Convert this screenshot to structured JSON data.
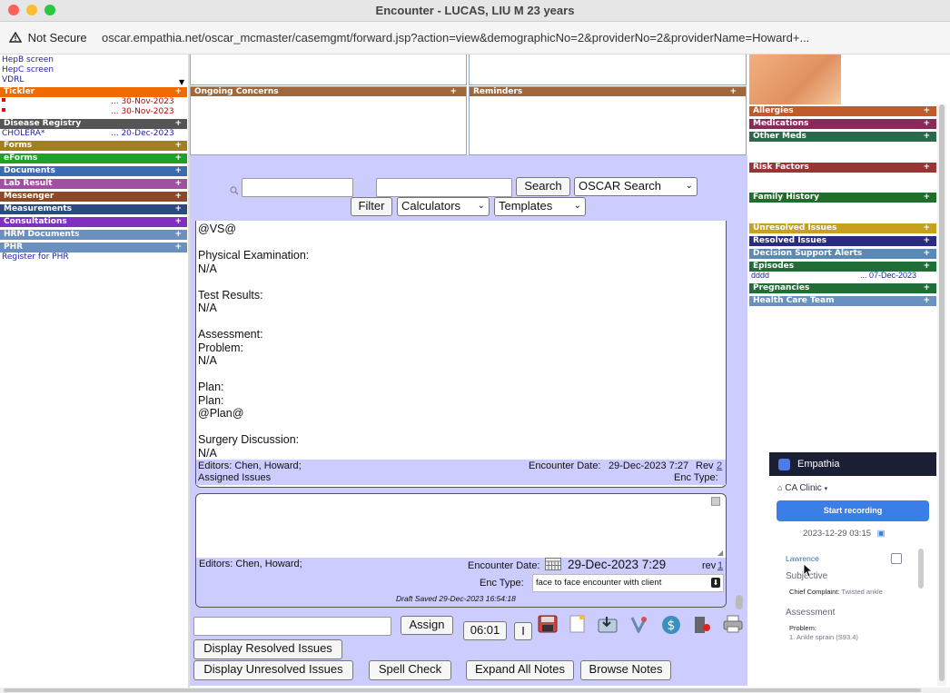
{
  "window": {
    "title": "Encounter - LUCAS, LIU M 23 years"
  },
  "address": {
    "security": "Not Secure",
    "url": "oscar.empathia.net/oscar_mcmaster/casemgmt/forward.jsp?action=view&demographicNo=2&providerNo=2&providerName=Howard+..."
  },
  "left": {
    "links": [
      "HepB screen",
      "HepC screen",
      "VDRL"
    ],
    "tickler": {
      "label": "Tickler",
      "rows": [
        "... 30-Nov-2023",
        "... 30-Nov-2023"
      ]
    },
    "disease_registry": {
      "label": "Disease Registry",
      "row_name": "CHOLERA*",
      "row_date": "... 20-Dec-2023"
    },
    "sections": [
      "Forms",
      "eForms",
      "Documents",
      "Lab Result",
      "Messenger",
      "Measurements",
      "Consultations",
      "HRM Documents",
      "PHR"
    ],
    "phr_link": "Register for PHR",
    "plus": "+"
  },
  "panels": {
    "ongoing": "Ongoing Concerns",
    "reminders": "Reminders"
  },
  "search": {
    "search_button": "Search",
    "oscar_search": "OSCAR Search",
    "filter_button": "Filter",
    "calculators": "Calculators",
    "templates": "Templates"
  },
  "note": {
    "lines": [
      "@VS@",
      "",
      "Physical Examination:",
      "N/A",
      "",
      "Test Results:",
      "N/A",
      "",
      "Assessment:",
      "Problem:",
      "N/A",
      "",
      "Plan:",
      "Plan:",
      "@Plan@",
      "",
      "Surgery Discussion:",
      "N/A"
    ],
    "editors": "Editors: Chen, Howard;",
    "encounter_date_label": "Encounter Date:",
    "encounter_date": "29-Dec-2023 7:27",
    "rev_label": "Rev",
    "rev": "2",
    "assigned_issues": "Assigned Issues",
    "enc_type_label": "Enc Type:"
  },
  "new_note": {
    "editors": "Editors: Chen, Howard;",
    "encounter_date_label": "Encounter Date:",
    "encounter_date": "29-Dec-2023 7:29",
    "rev_label": "rev",
    "rev": "1",
    "enc_type_label": "Enc Type:",
    "enc_type": "face to face encounter with client",
    "draft_saved": "Draft Saved 29-Dec-2023 16:54:18"
  },
  "bottom": {
    "assign": "Assign",
    "timer": "06:01",
    "pause": "I",
    "display_resolved": "Display Resolved Issues",
    "display_unresolved": "Display Unresolved Issues",
    "spell_check": "Spell Check",
    "expand_all": "Expand All Notes",
    "browse": "Browse Notes"
  },
  "right": {
    "sections": [
      {
        "label": "Allergies",
        "color": "#c05a2a"
      },
      {
        "label": "Medications",
        "color": "#8a2a5a"
      },
      {
        "label": "Other Meds",
        "color": "#2a6a4a"
      },
      {
        "label": "Risk Factors",
        "color": "#9a3535"
      },
      {
        "label": "Family History",
        "color": "#1f6e2a"
      },
      {
        "label": "Unresolved Issues",
        "color": "#c8a020"
      },
      {
        "label": "Resolved Issues",
        "color": "#2a2a80"
      },
      {
        "label": "Decision Support Alerts",
        "color": "#5a88b8"
      },
      {
        "label": "Episodes",
        "color": "#1f6e3a"
      },
      {
        "label": "Pregnancies",
        "color": "#1f6e3a"
      },
      {
        "label": "Health Care Team",
        "color": "#6a90c0"
      }
    ],
    "episode_name": "dddd",
    "episode_date": "... 07-Dec-2023"
  },
  "empathia": {
    "title": "Empathia",
    "clinic": "CA Clinic",
    "start": "Start recording",
    "datetime": "2023-12-29 03:15",
    "provider": "Lawrence",
    "subjective": "Subjective",
    "chief_label": "Chief Complaint:",
    "chief_value": "Twisted ankle",
    "assessment": "Assessment",
    "problem_label": "Problem:",
    "problem_value": "1. Ankle sprain (S93.4)"
  }
}
